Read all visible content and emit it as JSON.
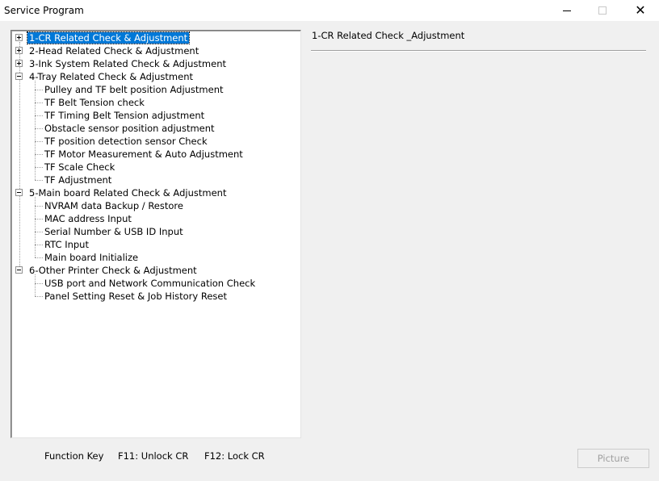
{
  "window": {
    "title": "Service Program",
    "controls": {
      "minimize": "minimize-icon",
      "maximize": "maximize-icon",
      "close": "close-icon"
    }
  },
  "tree": {
    "groups": [
      {
        "label": "1-CR Related Check & Adjustment",
        "expanded": false,
        "selected": true,
        "children": []
      },
      {
        "label": "2-Head Related Check & Adjustment",
        "expanded": false,
        "selected": false,
        "children": []
      },
      {
        "label": "3-Ink System Related Check & Adjustment",
        "expanded": false,
        "selected": false,
        "children": []
      },
      {
        "label": "4-Tray Related Check & Adjustment",
        "expanded": true,
        "selected": false,
        "children": [
          "Pulley and TF belt position Adjustment",
          "TF Belt Tension check",
          "TF Timing Belt Tension adjustment",
          "Obstacle sensor position adjustment",
          "TF position detection sensor Check",
          "TF Motor Measurement & Auto Adjustment",
          "TF Scale Check",
          "TF Adjustment"
        ]
      },
      {
        "label": "5-Main board Related Check & Adjustment",
        "expanded": true,
        "selected": false,
        "children": [
          "NVRAM data Backup / Restore",
          "MAC address Input",
          "Serial Number & USB ID Input",
          "RTC Input",
          "Main board Initialize"
        ]
      },
      {
        "label": "6-Other Printer Check & Adjustment",
        "expanded": true,
        "selected": false,
        "children": [
          "USB port and Network Communication Check",
          "Panel Setting Reset & Job History Reset"
        ]
      }
    ]
  },
  "detail": {
    "title": "1-CR Related Check _Adjustment"
  },
  "footer": {
    "function_key_label": "Function Key",
    "f11": "F11: Unlock CR",
    "f12": "F12: Lock CR",
    "picture_button": "Picture"
  },
  "colors": {
    "selection": "#0078d7",
    "background": "#f0f0f0"
  }
}
